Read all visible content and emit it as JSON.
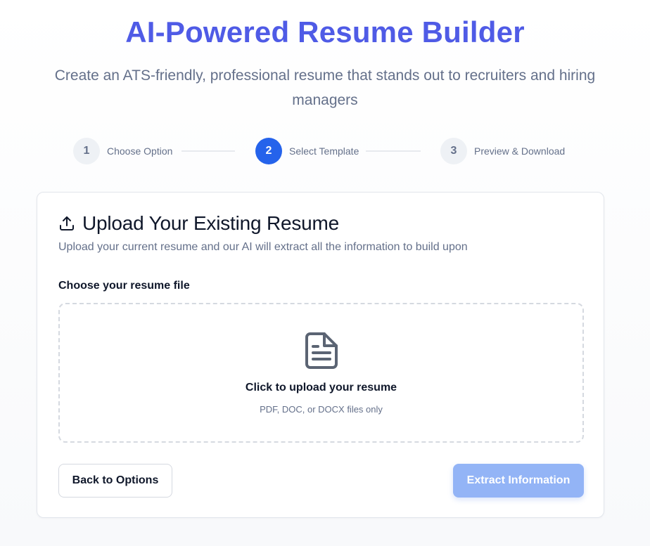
{
  "hero": {
    "title": "AI-Powered Resume Builder",
    "subtitle": "Create an ATS-friendly, professional resume that stands out to recruiters and hiring managers"
  },
  "steps": [
    {
      "number": "1",
      "label": "Choose Option",
      "active": false
    },
    {
      "number": "2",
      "label": "Select Template",
      "active": true
    },
    {
      "number": "3",
      "label": "Preview & Download",
      "active": false
    }
  ],
  "card": {
    "icon": "upload-icon",
    "title": "Upload Your Existing Resume",
    "description": "Upload your current resume and our AI will extract all the information to build upon",
    "field_label": "Choose your resume file",
    "dropzone": {
      "icon": "document-icon",
      "title": "Click to upload your resume",
      "hint": "PDF, DOC, or DOCX files only"
    },
    "back_label": "Back to Options",
    "extract_label": "Extract Information"
  },
  "colors": {
    "brand": "#4f5be6",
    "active_step": "#2563eb",
    "extract_disabled": "#93b4f6"
  }
}
